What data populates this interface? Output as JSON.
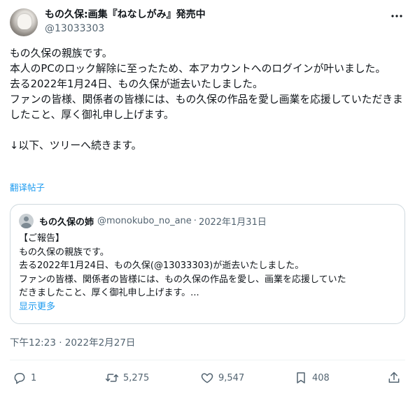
{
  "author": {
    "display_name": "もの久保:画集『ねなしがみ』発売中",
    "handle": "@13033303"
  },
  "post": {
    "paragraphs": [
      "もの久保の親族です。\n本人のPCのロック解除に至ったため、本アカウントへのログインが叶いました。\n去る2022年1月24日、もの久保が逝去いたしました。\nファンの皆様、関係者の皆様には、もの久保の作品を愛し画業を応援していただきましたこと、厚く御礼申し上げます。",
      "↓以下、ツリーへ続きます。"
    ],
    "translate_label": "翻译帖子",
    "timestamp": "下午12:23 · 2022年2月27日"
  },
  "quote": {
    "name": "もの久保の姉",
    "handle": "@monokubo_no_ane",
    "dot": "·",
    "date": "2022年1月31日",
    "lines": [
      "【ご報告】",
      "もの久保の親族です。",
      "去る2022年1月24日、もの久保(@13033303)が逝去いたしました。",
      "ファンの皆様、関係者の皆様には、もの久保の作品を愛し、画業を応援していた",
      "だきましたこと、厚く御礼申し上げます。..."
    ],
    "show_more": "显示更多"
  },
  "actions": {
    "replies": "1",
    "reposts": "5,275",
    "likes": "9,547",
    "bookmarks": "408"
  },
  "icons": {
    "more": "more-horizontal-icon",
    "reply": "reply-icon",
    "repost": "repost-icon",
    "like": "heart-icon",
    "bookmark": "bookmark-icon",
    "share": "share-icon"
  },
  "colors": {
    "text": "#0f1419",
    "secondary": "#536471",
    "link": "#1d9bf0",
    "border": "#cfd9de"
  }
}
